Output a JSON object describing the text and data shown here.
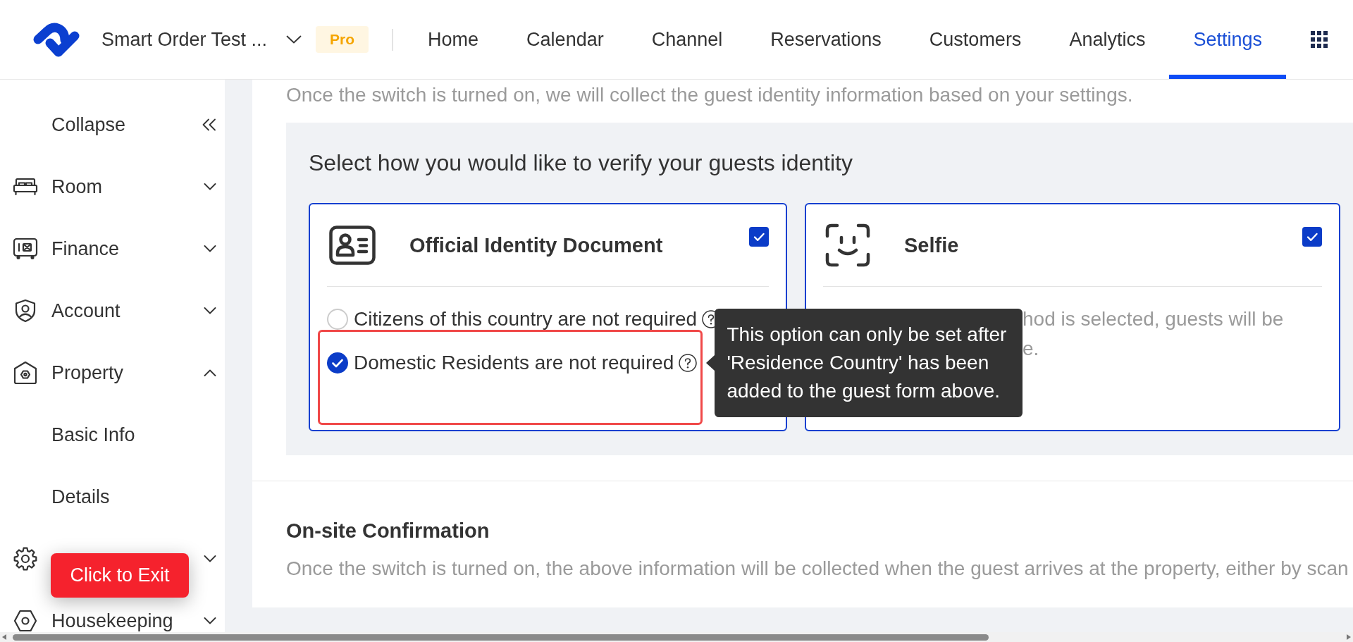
{
  "header": {
    "app_name": "Smart Order Test ...",
    "plan_badge": "Pro",
    "nav": [
      {
        "label": "Home",
        "selected": false
      },
      {
        "label": "Calendar",
        "selected": false
      },
      {
        "label": "Channel",
        "selected": false
      },
      {
        "label": "Reservations",
        "selected": false
      },
      {
        "label": "Customers",
        "selected": false
      },
      {
        "label": "Analytics",
        "selected": false
      },
      {
        "label": "Settings",
        "selected": true
      }
    ]
  },
  "sidebar": {
    "collapse": "Collapse",
    "items": [
      {
        "label": "Room",
        "expanded": false
      },
      {
        "label": "Finance",
        "expanded": false
      },
      {
        "label": "Account",
        "expanded": false
      },
      {
        "label": "Property",
        "expanded": true,
        "children": [
          {
            "label": "Basic Info",
            "selected": false
          },
          {
            "label": "Details",
            "selected": false
          }
        ]
      },
      {
        "expanded": false
      },
      {
        "label": "Housekeeping",
        "expanded": false
      }
    ]
  },
  "exit_button": "Click to Exit",
  "identity_section": {
    "description": "Once the switch is turned on, we will collect the guest identity information based on your settings.",
    "verify": {
      "title": "Select how you would like to verify your guests identity",
      "methods": [
        {
          "kind": "document",
          "title": "Official Identity Document",
          "checked": true,
          "options": [
            {
              "label": "Citizens of this country are not required",
              "selected": false,
              "highlighted": false
            },
            {
              "label": "Domestic Residents are not required",
              "selected": true,
              "highlighted": true,
              "tooltip": "This option can only be set after 'Residence Country' has been added to the guest form above."
            }
          ]
        },
        {
          "kind": "selfie",
          "title": "Selfie",
          "checked": true,
          "description_lines": [
            "hod is selected, guests will be",
            "e."
          ]
        }
      ]
    }
  },
  "onsite_section": {
    "title": "On-site Confirmation",
    "description": "Once the switch is turned on, the above information will be collected when the guest arrives at the property, either by scan"
  }
}
